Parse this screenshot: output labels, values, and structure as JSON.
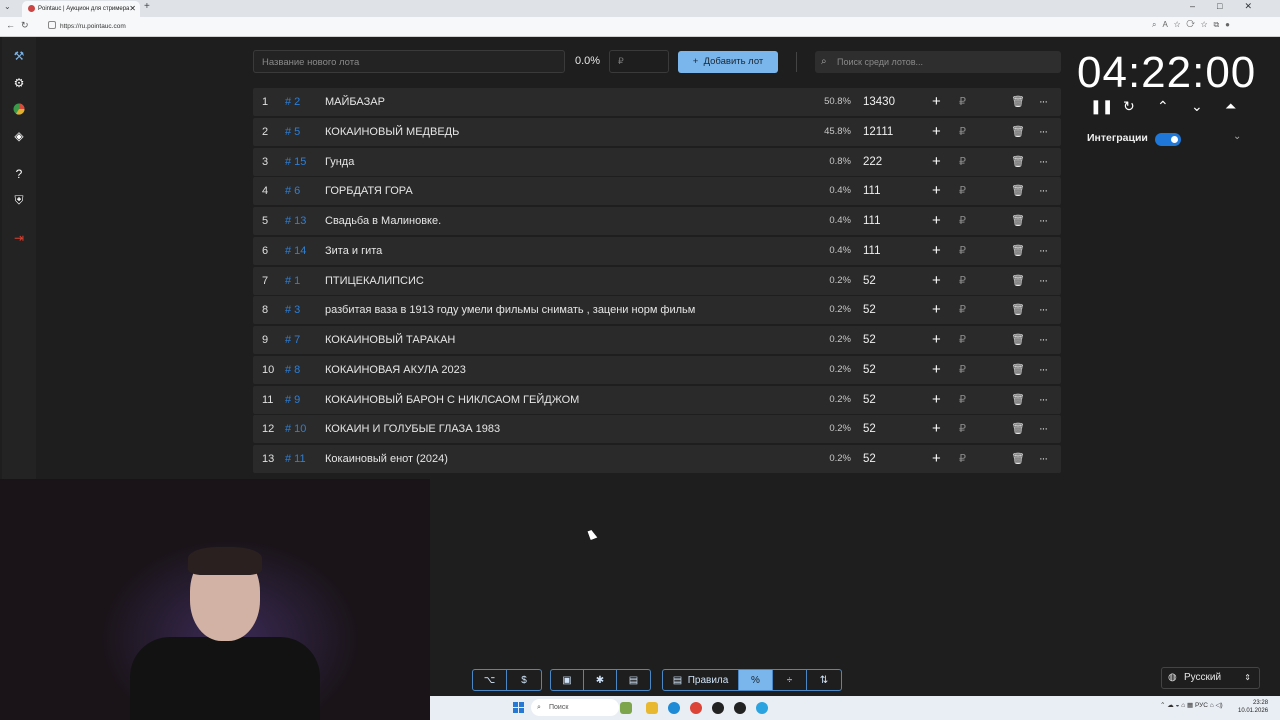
{
  "browser": {
    "tab_title": "Pointauc | Аукцион для стримера",
    "url": "https://ru.pointauc.com"
  },
  "toolbar": {
    "new_lot_placeholder": "Название нового лота",
    "percent": "0.0%",
    "amount_placeholder": "₽",
    "add_button": "Добавить лот",
    "search_placeholder": "Поиск среди лотов..."
  },
  "lots": [
    {
      "rank": "1",
      "id": "# 2",
      "name": "МАЙБАЗАР",
      "pct": "50.8%",
      "amount": "13430"
    },
    {
      "rank": "2",
      "id": "# 5",
      "name": "КОКАИНОВЫЙ МЕДВЕДЬ",
      "pct": "45.8%",
      "amount": "12111"
    },
    {
      "rank": "3",
      "id": "# 15",
      "name": "Гунда",
      "pct": "0.8%",
      "amount": "222"
    },
    {
      "rank": "4",
      "id": "# 6",
      "name": "ГОРБДАТЯ ГОРА",
      "pct": "0.4%",
      "amount": "111"
    },
    {
      "rank": "5",
      "id": "# 13",
      "name": "Свадьба в Малиновке.",
      "pct": "0.4%",
      "amount": "111"
    },
    {
      "rank": "6",
      "id": "# 14",
      "name": "Зита и гита",
      "pct": "0.4%",
      "amount": "111"
    },
    {
      "rank": "7",
      "id": "# 1",
      "name": "ПТИЦЕКАЛИПСИС",
      "pct": "0.2%",
      "amount": "52"
    },
    {
      "rank": "8",
      "id": "# 3",
      "name": "разбитая ваза в 1913 году умели фильмы снимать , зацени норм фильм",
      "pct": "0.2%",
      "amount": "52"
    },
    {
      "rank": "9",
      "id": "# 7",
      "name": "КОКАИНОВЫЙ ТАРАКАН",
      "pct": "0.2%",
      "amount": "52"
    },
    {
      "rank": "10",
      "id": "# 8",
      "name": "КОКАИНОВАЯ АКУЛА 2023",
      "pct": "0.2%",
      "amount": "52"
    },
    {
      "rank": "11",
      "id": "# 9",
      "name": "КОКАИНОВЫЙ БАРОН С НИКЛСАОМ ГЕЙДЖОМ",
      "pct": "0.2%",
      "amount": "52"
    },
    {
      "rank": "12",
      "id": "# 10",
      "name": "КОКАИН И ГОЛУБЫЕ ГЛАЗА 1983",
      "pct": "0.2%",
      "amount": "52"
    },
    {
      "rank": "13",
      "id": "# 11",
      "name": "Кокаиновый енот (2024)",
      "pct": "0.2%",
      "amount": "52"
    }
  ],
  "row_labels": {
    "plus": "+",
    "currency": "₽",
    "delete": "🗑",
    "more": "···"
  },
  "timer": {
    "value": "04:22:00"
  },
  "integrations": {
    "label": "Интеграции",
    "enabled": true
  },
  "bottom_bar": {
    "rules_label": "Правила",
    "percent_label": "%",
    "language": "Русский"
  },
  "taskbar": {
    "search_placeholder": "Поиск",
    "lang": "РУС",
    "time": "23:28",
    "date": "10.01.2026"
  },
  "colors": {
    "accent": "#7ab6ec",
    "id_blue": "#2f7fd6",
    "background": "#1e1e1e",
    "row": "#2a2a2a"
  }
}
